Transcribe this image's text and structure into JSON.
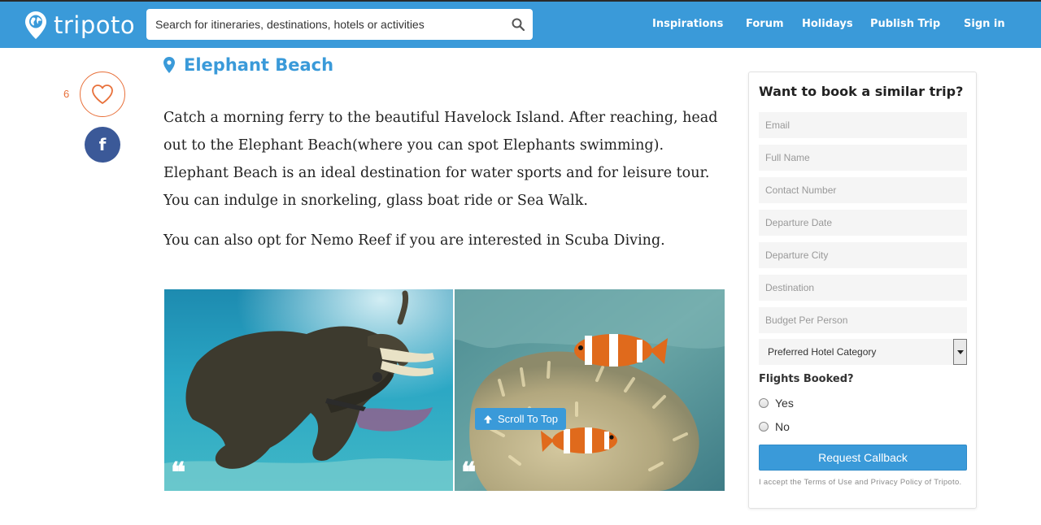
{
  "header": {
    "logo_text": "tripoto",
    "search": {
      "placeholder": "Search for itineraries, destinations, hotels or activities"
    },
    "nav": [
      "Inspirations",
      "Forum",
      "Holidays",
      "Publish Trip",
      "Sign in"
    ]
  },
  "colors": {
    "brand": "#3a9ad9",
    "like_accent": "#e8703a",
    "facebook": "#3b5998"
  },
  "social": {
    "like_count": "6",
    "like_icon": "heart-icon",
    "share_icon": "facebook-icon"
  },
  "article": {
    "place_icon": "map-pin-icon",
    "place_title": "Elephant Beach",
    "paragraphs": [
      "Catch a morning ferry to the beautiful Havelock Island. After reaching, head out to the Elephant Beach(where you can spot Elephants swimming). Elephant Beach is an ideal destination for water sports and for leisure tour. You can indulge in snorkeling, glass boat ride or Sea Walk.",
      "You can also opt for Nemo Reef if you are interested in Scuba Diving."
    ],
    "photos": [
      {
        "subject": "Elephant swimming underwater with a snorkeler",
        "caption_icon": "quote-icon"
      },
      {
        "subject": "Clownfish in a sea anemone",
        "caption_icon": "quote-icon"
      }
    ],
    "scroll_top_label": "Scroll To Top"
  },
  "booking": {
    "title": "Want to book a similar trip?",
    "fields": [
      {
        "placeholder": "Email",
        "value": ""
      },
      {
        "placeholder": "Full Name",
        "value": ""
      },
      {
        "placeholder": "Contact Number",
        "value": ""
      },
      {
        "placeholder": "Departure Date",
        "value": ""
      },
      {
        "placeholder": "Departure City",
        "value": ""
      },
      {
        "placeholder": "Destination",
        "value": ""
      },
      {
        "placeholder": "Budget Per Person",
        "value": ""
      }
    ],
    "hotel_select": {
      "selected": "Preferred Hotel Category"
    },
    "flights_label": "Flights Booked?",
    "flight_options": [
      "Yes",
      "No"
    ],
    "submit_label": "Request Callback",
    "terms": "I accept the Terms of Use and Privacy Policy of Tripoto."
  }
}
